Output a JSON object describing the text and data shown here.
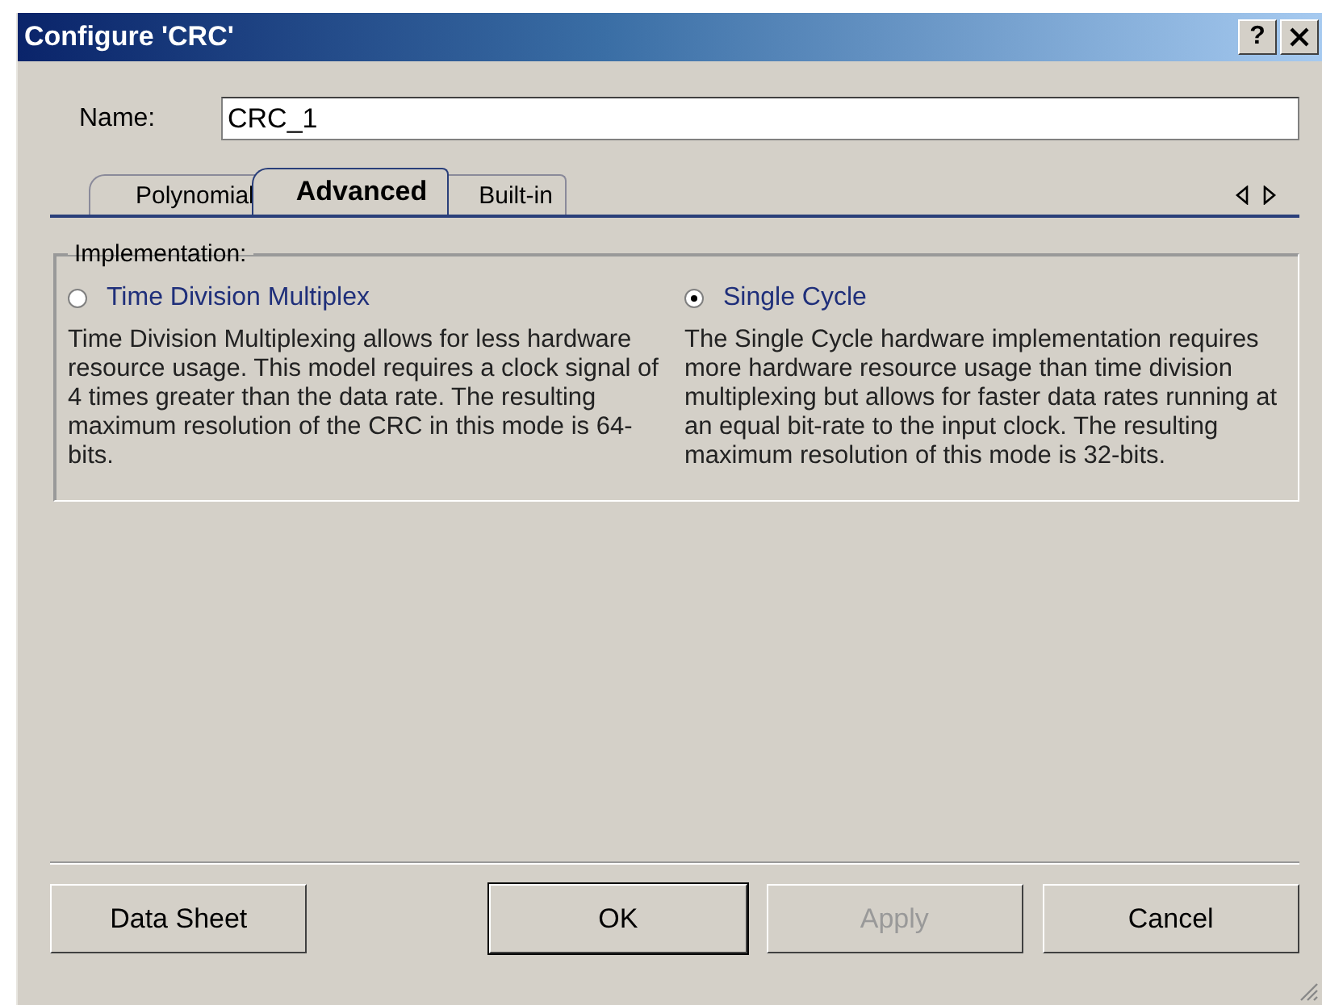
{
  "window": {
    "title": "Configure 'CRC'",
    "help": "?"
  },
  "name_field": {
    "label": "Name:",
    "value": "CRC_1"
  },
  "tabs": [
    {
      "label": "Polynomial",
      "selected": false
    },
    {
      "label": "Advanced",
      "selected": true
    },
    {
      "label": "Built-in",
      "selected": false
    }
  ],
  "group": {
    "title": "Implementation:",
    "options": [
      {
        "label": "Time Division Multiplex",
        "selected": false,
        "description": "Time Division Multiplexing allows for less hardware resource usage.  This model requires a clock signal of 4 times greater than the data rate.  The  resulting maximum resolution of the CRC in this mode is 64-bits."
      },
      {
        "label": "Single Cycle",
        "selected": true,
        "description": "The Single Cycle hardware implementation requires more hardware resource usage than time division multiplexing but allows for faster data rates running at an equal bit-rate to the input clock.  The resulting maximum resolution of this mode is 32-bits."
      }
    ]
  },
  "buttons": [
    {
      "label": "Data Sheet",
      "disabled": false,
      "default": false
    },
    {
      "label": "OK",
      "disabled": false,
      "default": true
    },
    {
      "label": "Apply",
      "disabled": true,
      "default": false
    },
    {
      "label": "Cancel",
      "disabled": false,
      "default": false
    }
  ]
}
